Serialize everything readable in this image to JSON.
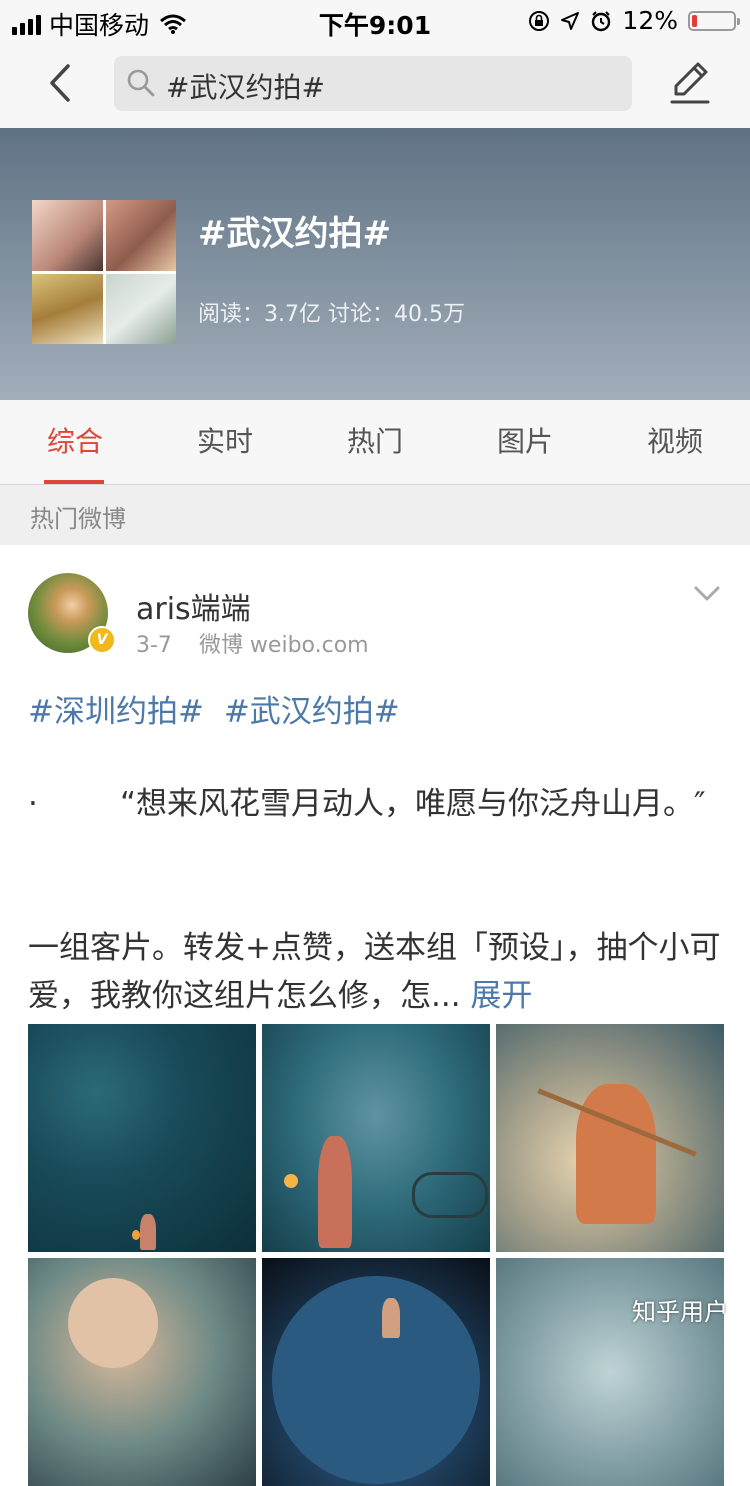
{
  "status_bar": {
    "carrier": "中国移动",
    "time": "下午9:01",
    "battery_percent_text": "12%",
    "battery_level": 0.12,
    "icons": [
      "signal-icon",
      "wifi-icon",
      "rotation-lock-icon",
      "location-icon",
      "alarm-icon",
      "battery-icon"
    ]
  },
  "nav": {
    "search_text": "#武汉约拍#",
    "icons": [
      "back-icon",
      "search-icon",
      "edit-icon"
    ]
  },
  "topic": {
    "title": "#武汉约拍#",
    "stats": "阅读：3.7亿  讨论：40.5万"
  },
  "tabs": [
    {
      "label": "综合",
      "active": true
    },
    {
      "label": "实时",
      "active": false
    },
    {
      "label": "热门",
      "active": false
    },
    {
      "label": "图片",
      "active": false
    },
    {
      "label": "视频",
      "active": false
    }
  ],
  "section": {
    "label": "热门微博"
  },
  "post": {
    "author": "aris端端",
    "date": "3-7",
    "source": "微博 weibo.com",
    "tags": [
      "#深圳约拍#",
      "#武汉约拍#"
    ],
    "quote_dot": "·",
    "quote": "“想来风花雪月动人，唯愿与你泛舟山月。″",
    "body": "一组客片。转发+点赞，送本组「预设」，抽个小可爱，我教你这组片怎么修，怎... ",
    "expand_label": "展开",
    "verified_badge": "V"
  },
  "colors": {
    "accent_red": "#e0453a",
    "link_blue": "#4d79a8",
    "verified_gold": "#f2b719"
  },
  "watermark": "知乎用户"
}
